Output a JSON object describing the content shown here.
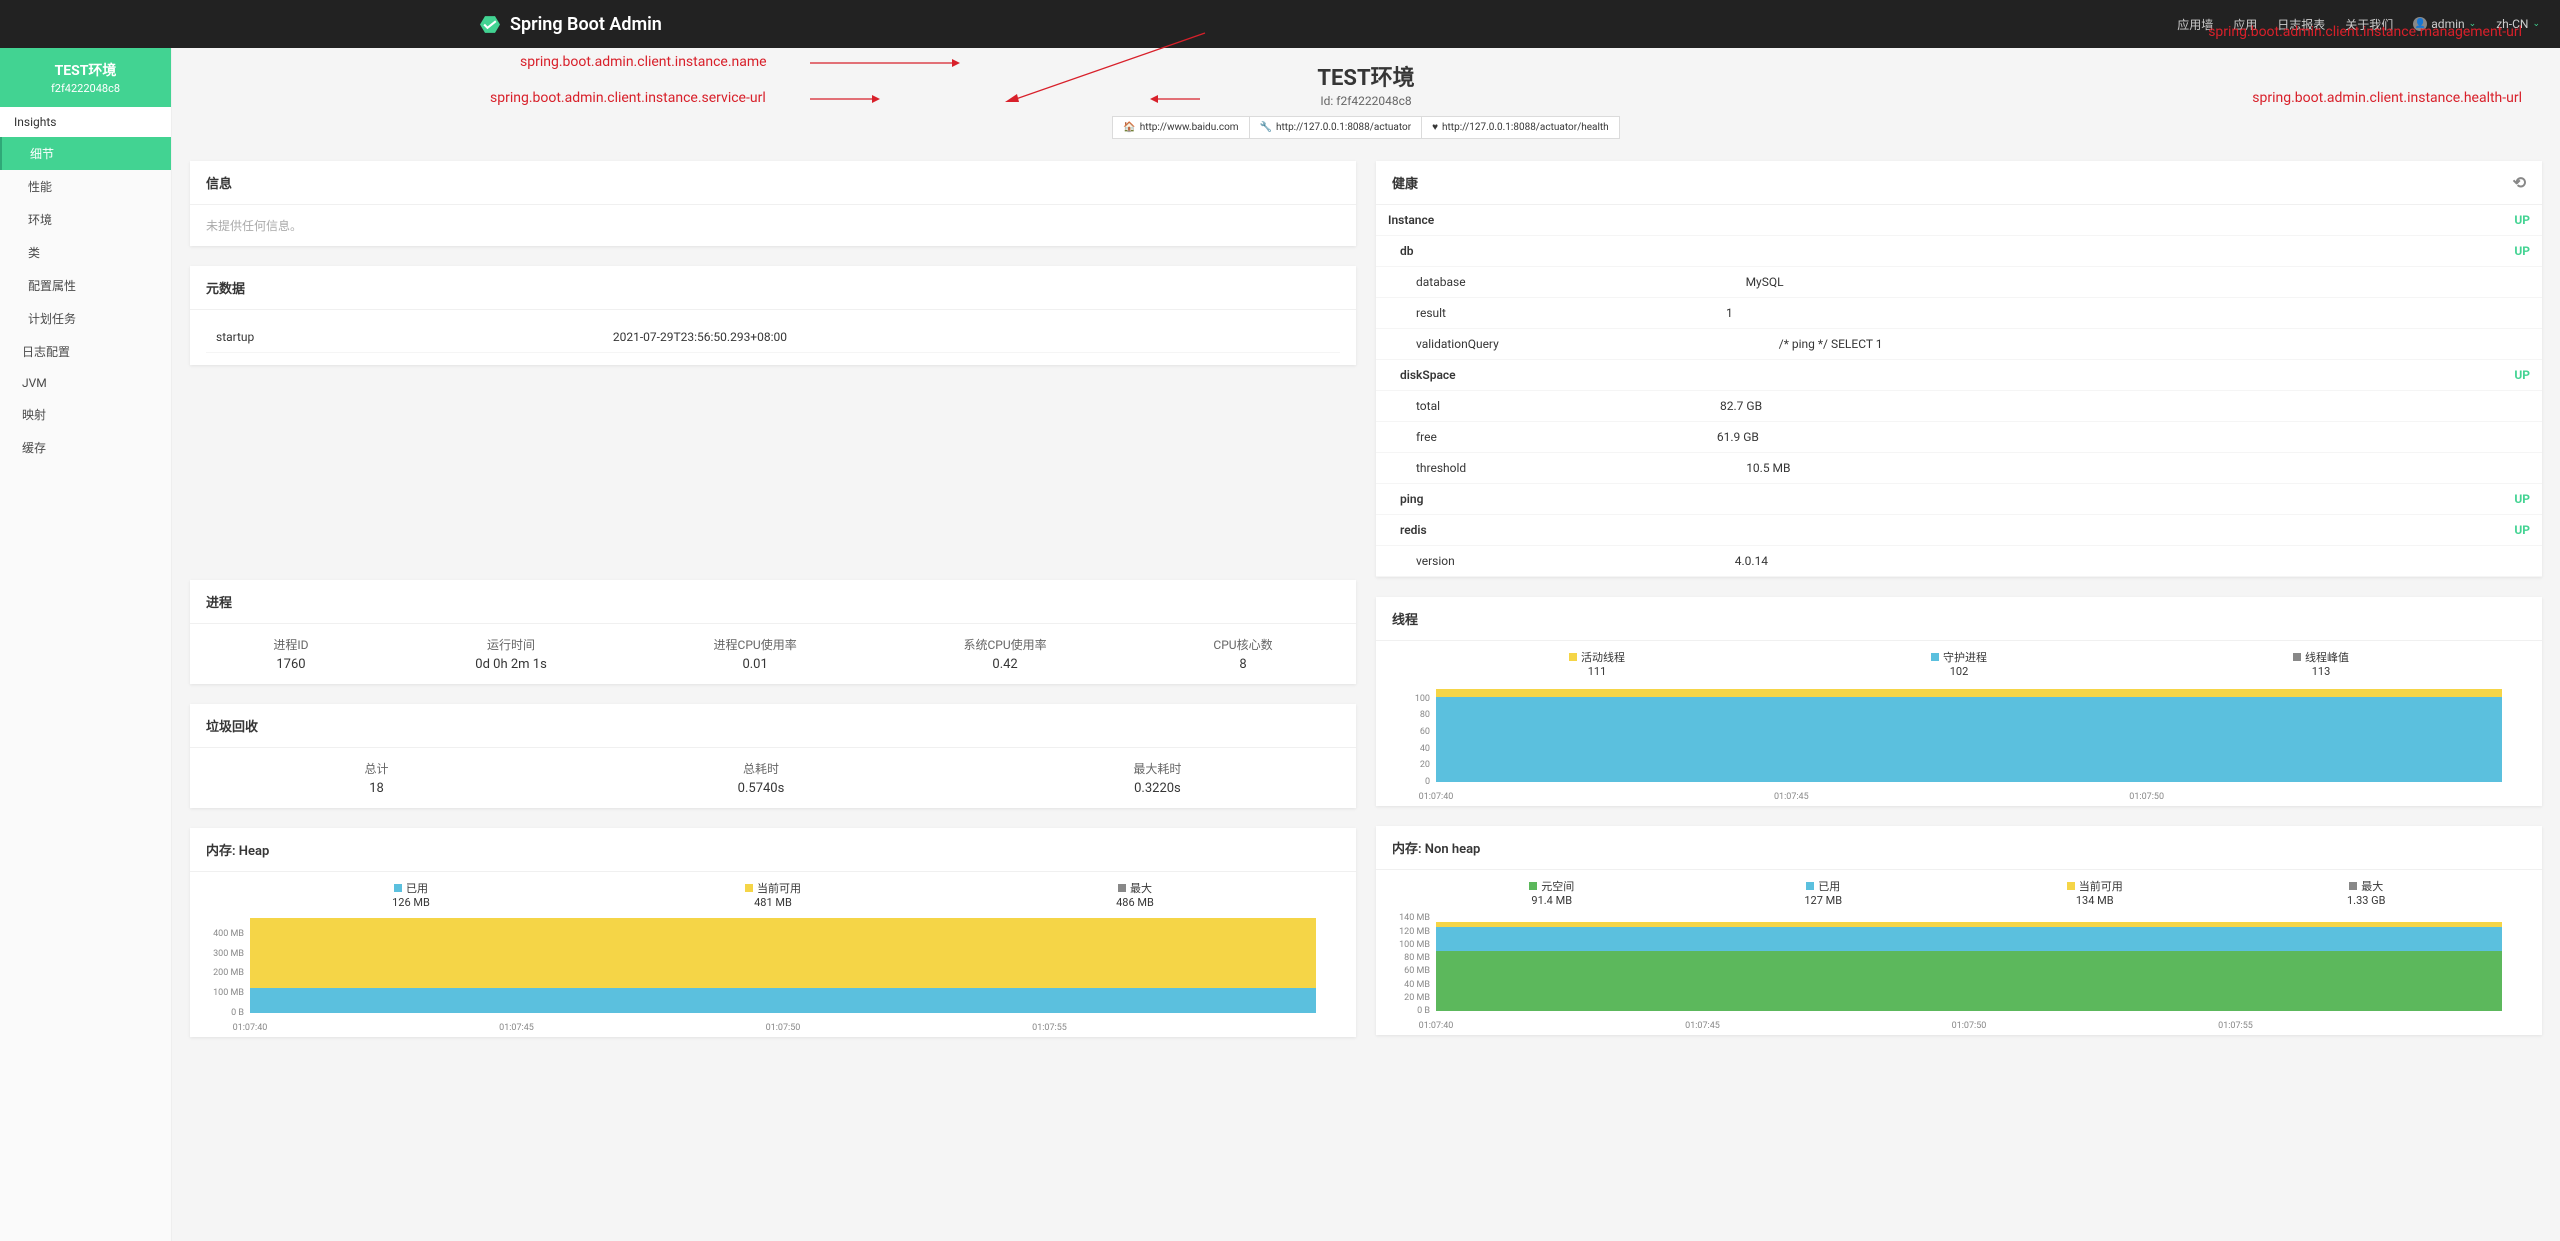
{
  "brand": "Spring Boot Admin",
  "topnav": {
    "wallboard": "应用墙",
    "applications": "应用",
    "journal": "日志报表",
    "about": "关于我们",
    "user": "admin",
    "lang": "zh-CN"
  },
  "sidebar": {
    "app_name": "TEST环境",
    "app_id": "f2f4222048c8",
    "section1": "Insights",
    "items1": [
      "细节",
      "性能",
      "环境",
      "类",
      "配置属性",
      "计划任务"
    ],
    "section2": "日志配置",
    "section3": "JVM",
    "section4": "映射",
    "section5": "缓存"
  },
  "page": {
    "title": "TEST环境",
    "id_label": "Id: f2f4222048c8",
    "urls": {
      "service": "http://www.baidu.com",
      "management": "http://127.0.0.1:8088/actuator",
      "health": "http://127.0.0.1:8088/actuator/health"
    }
  },
  "annotations": {
    "name": "spring.boot.admin.client.instance.name",
    "service_url": "spring.boot.admin.client.instance.service-url",
    "management_url": "spring.boot.admin.client.instance.management-url",
    "health_url": "spring.boot.admin.client.instance.health-url"
  },
  "info_card": {
    "title": "信息",
    "empty": "未提供任何信息。"
  },
  "metadata_card": {
    "title": "元数据",
    "rows": [
      {
        "k": "startup",
        "v": "2021-07-29T23:56:50.293+08:00"
      }
    ]
  },
  "health_card": {
    "title": "健康",
    "instance": {
      "label": "Instance",
      "status": "UP"
    },
    "db": {
      "label": "db",
      "status": "UP",
      "details": [
        {
          "k": "database",
          "v": "MySQL"
        },
        {
          "k": "result",
          "v": "1"
        },
        {
          "k": "validationQuery",
          "v": "/* ping */ SELECT 1"
        }
      ]
    },
    "diskSpace": {
      "label": "diskSpace",
      "status": "UP",
      "details": [
        {
          "k": "total",
          "v": "82.7 GB"
        },
        {
          "k": "free",
          "v": "61.9 GB"
        },
        {
          "k": "threshold",
          "v": "10.5 MB"
        }
      ]
    },
    "ping": {
      "label": "ping",
      "status": "UP"
    },
    "redis": {
      "label": "redis",
      "status": "UP",
      "details": [
        {
          "k": "version",
          "v": "4.0.14"
        }
      ]
    }
  },
  "process_card": {
    "title": "进程",
    "stats": [
      {
        "label": "进程ID",
        "value": "1760"
      },
      {
        "label": "运行时间",
        "value": "0d 0h 2m 1s"
      },
      {
        "label": "进程CPU使用率",
        "value": "0.01"
      },
      {
        "label": "系统CPU使用率",
        "value": "0.42"
      },
      {
        "label": "CPU核心数",
        "value": "8"
      }
    ]
  },
  "gc_card": {
    "title": "垃圾回收",
    "stats": [
      {
        "label": "总计",
        "value": "18"
      },
      {
        "label": "总耗时",
        "value": "0.5740s"
      },
      {
        "label": "最大耗时",
        "value": "0.3220s"
      }
    ]
  },
  "threads_card": {
    "title": "线程",
    "legend": [
      {
        "label": "活动线程",
        "value": "111",
        "color": "#f5d547"
      },
      {
        "label": "守护进程",
        "value": "102",
        "color": "#5bc0de"
      },
      {
        "label": "线程峰值",
        "value": "113",
        "color": "#888"
      }
    ]
  },
  "heap_card": {
    "title": "内存: Heap",
    "legend": [
      {
        "label": "已用",
        "value": "126 MB",
        "color": "#5bc0de"
      },
      {
        "label": "当前可用",
        "value": "481 MB",
        "color": "#f5d547"
      },
      {
        "label": "最大",
        "value": "486 MB",
        "color": "#888"
      }
    ]
  },
  "nonheap_card": {
    "title": "内存: Non heap",
    "legend": [
      {
        "label": "元空间",
        "value": "91.4 MB",
        "color": "#5cb85c"
      },
      {
        "label": "已用",
        "value": "127 MB",
        "color": "#5bc0de"
      },
      {
        "label": "当前可用",
        "value": "134 MB",
        "color": "#f5d547"
      },
      {
        "label": "最大",
        "value": "1.33 GB",
        "color": "#888"
      }
    ]
  },
  "chart_data": [
    {
      "type": "area",
      "title": "线程",
      "x": [
        "01:07:40",
        "01:07:45",
        "01:07:50"
      ],
      "series": [
        {
          "name": "活动线程",
          "values": [
            111,
            111,
            111
          ],
          "color": "#f5d547"
        },
        {
          "name": "守护进程",
          "values": [
            102,
            102,
            102
          ],
          "color": "#5bc0de"
        }
      ],
      "yticks": [
        0,
        20,
        40,
        60,
        80,
        100
      ],
      "ylim": [
        0,
        115
      ]
    },
    {
      "type": "area",
      "title": "内存: Heap",
      "x": [
        "01:07:40",
        "01:07:45",
        "01:07:50",
        "01:07:55"
      ],
      "series": [
        {
          "name": "当前可用",
          "values": [
            481,
            481,
            481,
            481
          ],
          "unit": "MB",
          "color": "#f5d547"
        },
        {
          "name": "已用",
          "values": [
            126,
            126,
            126,
            126
          ],
          "unit": "MB",
          "color": "#5bc0de"
        }
      ],
      "yticks_labels": [
        "0 B",
        "100 MB",
        "200 MB",
        "300 MB",
        "400 MB"
      ],
      "yticks": [
        0,
        100,
        200,
        300,
        400
      ],
      "ylim": [
        0,
        486
      ]
    },
    {
      "type": "area",
      "title": "内存: Non heap",
      "x": [
        "01:07:40",
        "01:07:45",
        "01:07:50",
        "01:07:55"
      ],
      "series": [
        {
          "name": "当前可用",
          "values": [
            134,
            134,
            134,
            134
          ],
          "unit": "MB",
          "color": "#f5d547"
        },
        {
          "name": "已用",
          "values": [
            127,
            127,
            127,
            127
          ],
          "unit": "MB",
          "color": "#5bc0de"
        },
        {
          "name": "元空间",
          "values": [
            91.4,
            91.4,
            91.4,
            91.4
          ],
          "unit": "MB",
          "color": "#5cb85c"
        }
      ],
      "yticks_labels": [
        "0 B",
        "20 MB",
        "40 MB",
        "60 MB",
        "80 MB",
        "100 MB",
        "120 MB",
        "140 MB"
      ],
      "yticks": [
        0,
        20,
        40,
        60,
        80,
        100,
        120,
        140
      ],
      "ylim": [
        0,
        145
      ]
    }
  ]
}
